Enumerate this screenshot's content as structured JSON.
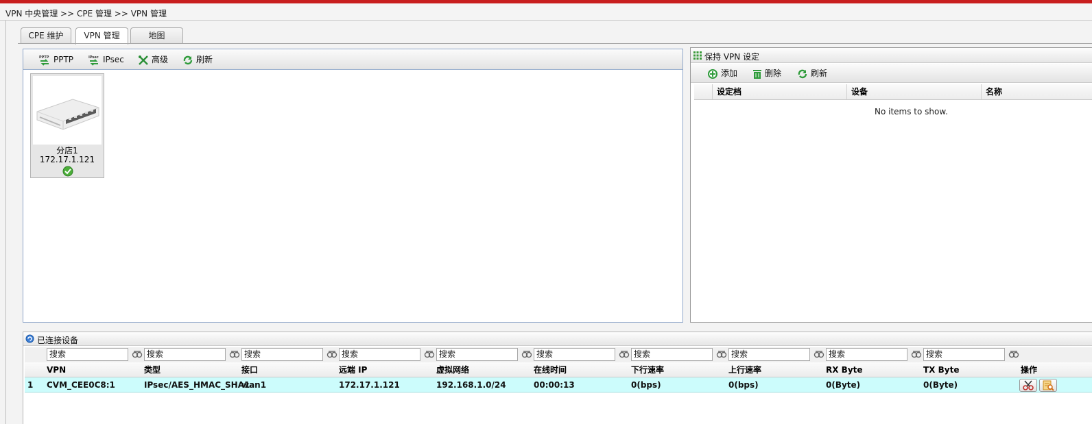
{
  "breadcrumb": "VPN 中央管理 >> CPE 管理 >> VPN 管理",
  "tabs": [
    "CPE 维护",
    "VPN 管理",
    "地图"
  ],
  "active_tab": 1,
  "left_toolbar": {
    "pptp": "PPTP",
    "ipsec": "IPsec",
    "advanced": "高级",
    "refresh": "刷新",
    "pptp_badge": "PPTP",
    "ipsec_badge": "IPsec"
  },
  "device": {
    "name": "分店1",
    "ip": "172.17.1.121",
    "status": "online"
  },
  "keep_vpn": {
    "title": "保持 VPN 设定",
    "add": "添加",
    "delete": "删除",
    "refresh": "刷新",
    "columns": [
      "设定档",
      "设备",
      "名称"
    ],
    "empty": "No items to show."
  },
  "connected": {
    "title": "已连接设备",
    "search_placeholder": "搜索",
    "columns": [
      "VPN",
      "类型",
      "接口",
      "远端 IP",
      "虚拟网络",
      "在线时间",
      "下行速率",
      "上行速率",
      "RX Byte",
      "TX Byte",
      "操作"
    ],
    "rows": [
      {
        "no": "1",
        "vpn": "CVM_CEE0C8:1",
        "type": "IPsec/AES_HMAC_SHA1",
        "iface": "wan1",
        "remote_ip": "172.17.1.121",
        "vnet": "192.168.1.0/24",
        "uptime": "00:00:13",
        "down": "0(bps)",
        "up": "0(bps)",
        "rx": "0(Byte)",
        "tx": "0(Byte)"
      }
    ]
  },
  "colors": {
    "top_accent": "#c81e1e",
    "selected_row": "#ccfcfc",
    "toolbar_green": "#2e9b3a"
  }
}
